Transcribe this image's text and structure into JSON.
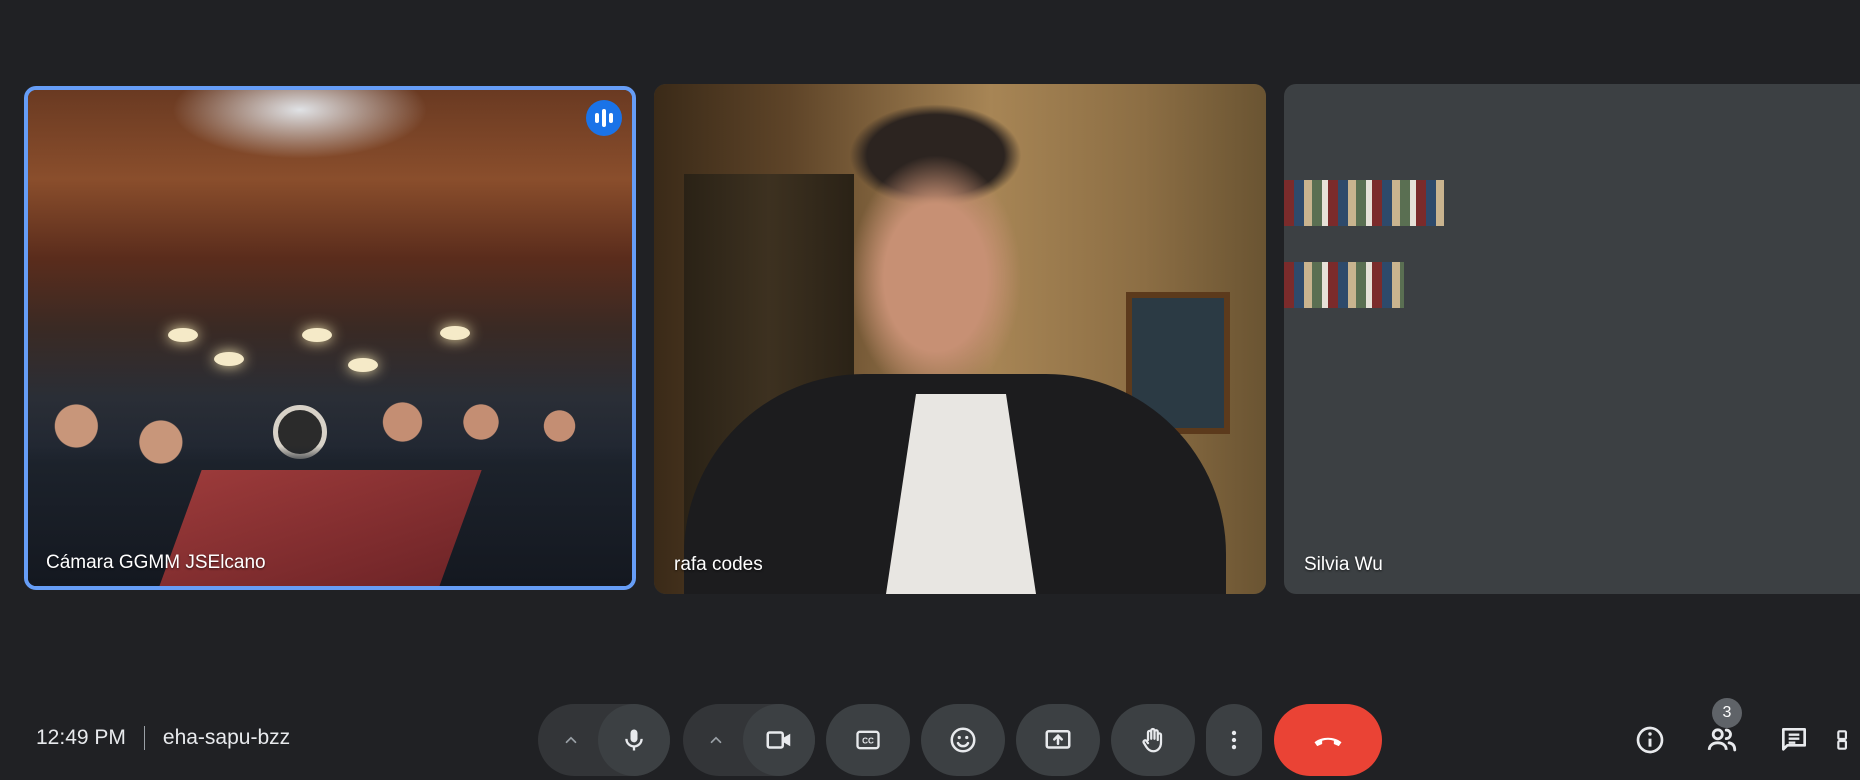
{
  "participants": [
    {
      "name": "Cámara GGMM JSElcano",
      "speaking": true
    },
    {
      "name": "rafa codes",
      "speaking": false
    },
    {
      "name": "Silvia Wu",
      "speaking": false
    }
  ],
  "meeting": {
    "time": "12:49 PM",
    "code": "eha-sapu-bzz"
  },
  "controls": {
    "mic_options_icon": "chevron-up-icon",
    "mic_icon": "microphone-icon",
    "camera_options_icon": "chevron-up-icon",
    "camera_icon": "video-camera-icon",
    "captions_icon": "closed-captions-icon",
    "emoji_icon": "emoji-icon",
    "present_icon": "present-screen-icon",
    "raise_hand_icon": "raise-hand-icon",
    "more_icon": "more-vertical-icon",
    "hangup_icon": "hang-up-icon"
  },
  "right_controls": {
    "info_icon": "info-icon",
    "people_icon": "people-icon",
    "people_count": "3",
    "chat_icon": "chat-icon"
  },
  "colors": {
    "background": "#202124",
    "active_speaker_border": "#669df6",
    "speaking_badge": "#1a73e8",
    "hangup": "#ea4335",
    "control": "#3c4043"
  }
}
